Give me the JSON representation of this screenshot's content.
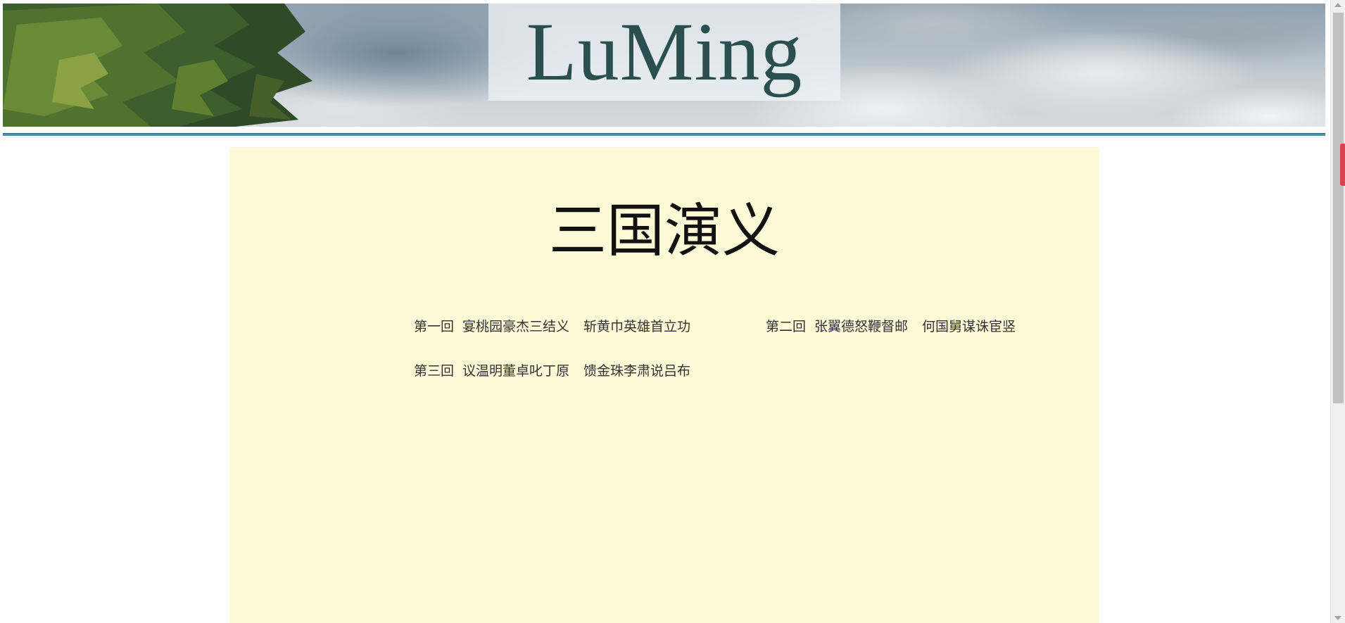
{
  "header": {
    "logo_text": "LuMing",
    "logo_color": "#2b4f4e",
    "divider_color": "#4f8fa6"
  },
  "main": {
    "background_color": "#fef9d6",
    "title": "三国演义",
    "chapters": [
      {
        "number": "第一回",
        "part1": "宴桃园豪杰三结义",
        "part2": "斩黄巾英雄首立功"
      },
      {
        "number": "第二回",
        "part1": "张翼德怒鞭督邮",
        "part2": "何国舅谋诛宦竖"
      },
      {
        "number": "第三回",
        "part1": "议温明董卓叱丁原",
        "part2": "馈金珠李肃说吕布"
      }
    ]
  }
}
